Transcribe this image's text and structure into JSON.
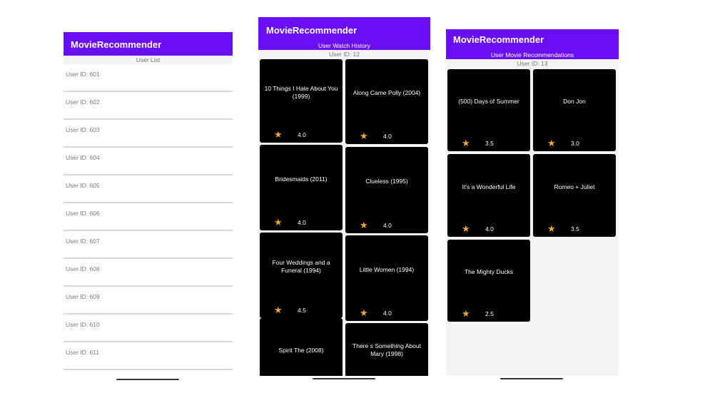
{
  "app_title": "MovieRecommender",
  "screen1": {
    "header": "User List",
    "users": [
      "User ID: 601",
      "User ID: 602",
      "User ID: 603",
      "User ID: 604",
      "User ID: 605",
      "User ID: 606",
      "User ID: 607",
      "User ID: 608",
      "User ID: 609",
      "User ID: 610",
      "User ID: 611"
    ]
  },
  "screen2": {
    "title": "User Watch History",
    "user_id": "User ID: 12",
    "movies": [
      {
        "title": "10 Things I Hate About You (1999)",
        "rating": "4.0"
      },
      {
        "title": "Along Came Polly (2004)",
        "rating": "4.0"
      },
      {
        "title": "Bridesmaids (2011)",
        "rating": "4.0"
      },
      {
        "title": "Clueless (1995)",
        "rating": "4.0"
      },
      {
        "title": "Four Weddings and a Funeral (1994)",
        "rating": "4.5"
      },
      {
        "title": "Little Women (1994)",
        "rating": "4.0"
      },
      {
        "title": "Spirit  The (2008)",
        "rating": ""
      },
      {
        "title": "There s Something About Mary (1998)",
        "rating": ""
      }
    ]
  },
  "screen3": {
    "title": "User Movie Recommendations",
    "user_id": "User ID: 13",
    "movies": [
      {
        "title": "(500) Days of Summer",
        "rating": "3.5"
      },
      {
        "title": "Don Jon",
        "rating": "3.0"
      },
      {
        "title": "It's a Wonderful Life",
        "rating": "4.0"
      },
      {
        "title": "Romeo + Juliet",
        "rating": "3.5"
      },
      {
        "title": "The Mighty Ducks",
        "rating": "2.5"
      }
    ]
  },
  "icons": {
    "star": "star-icon"
  },
  "colors": {
    "appbar": "#6a0ff5",
    "star": "#f5a623",
    "card": "#000000"
  }
}
